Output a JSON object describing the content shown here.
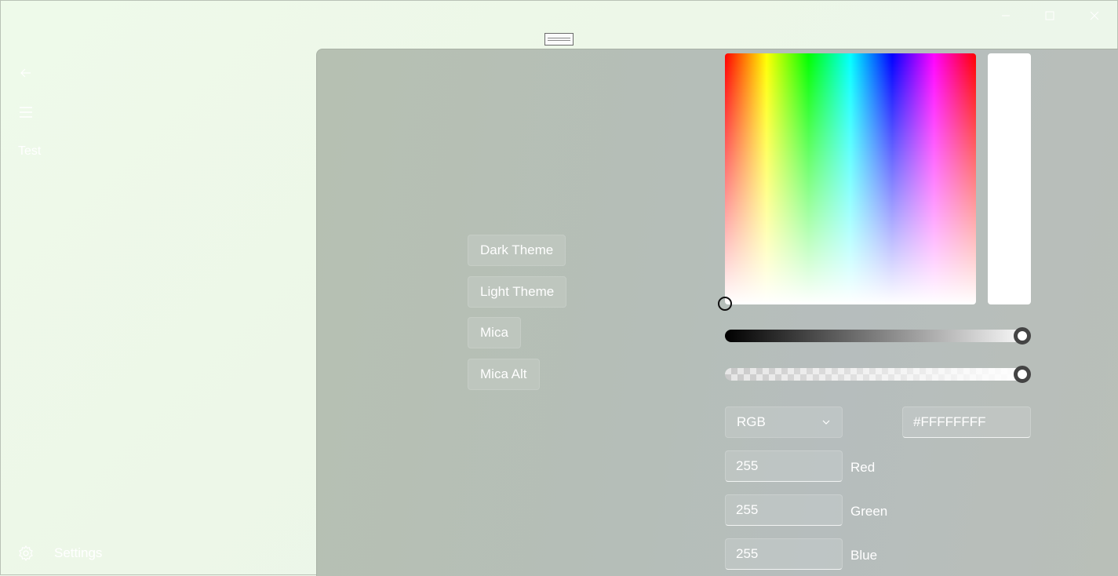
{
  "titlebar": {
    "minimize_icon": "minimize-icon",
    "maximize_icon": "maximize-icon",
    "close_icon": "close-icon"
  },
  "nav": {
    "items": [
      {
        "label": "Test"
      }
    ],
    "settings_label": "Settings"
  },
  "themes": {
    "buttons": [
      {
        "label": "Dark Theme"
      },
      {
        "label": "Light Theme"
      },
      {
        "label": "Mica"
      },
      {
        "label": "Mica Alt"
      }
    ]
  },
  "color_picker": {
    "mode": "RGB",
    "hex": "#FFFFFFFF",
    "preview_color": "#FFFFFF",
    "value_level": 1.0,
    "alpha_level": 1.0,
    "channels": [
      {
        "value": "255",
        "label": "Red"
      },
      {
        "value": "255",
        "label": "Green"
      },
      {
        "value": "255",
        "label": "Blue"
      }
    ]
  }
}
